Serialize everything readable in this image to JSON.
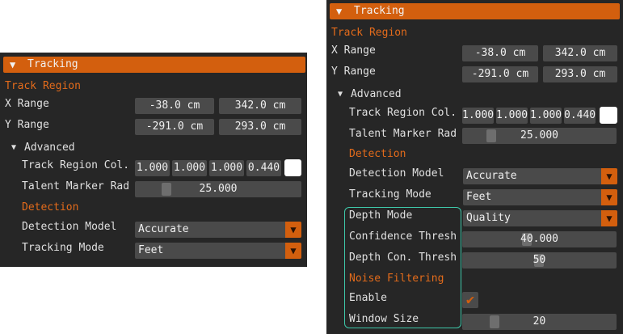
{
  "left_panel": {
    "header": {
      "arrow": "▼",
      "title": "Tracking"
    },
    "track_region": {
      "section": "Track Region",
      "x_range": {
        "label": "X Range",
        "min": "-38.0 cm",
        "max": "342.0 cm"
      },
      "y_range": {
        "label": "Y Range",
        "min": "-291.0 cm",
        "max": "293.0 cm"
      }
    },
    "advanced": {
      "arrow": "▼",
      "label": "Advanced",
      "track_region_color": {
        "label": "Track Region Col.",
        "r": "1.000",
        "g": "1.000",
        "b": "1.000",
        "a": "0.440"
      },
      "talent_marker_radius": {
        "label": "Talent Marker Rad",
        "value": "25.000"
      }
    },
    "detection": {
      "section": "Detection",
      "detection_model": {
        "label": "Detection Model",
        "value": "Accurate",
        "arrow": "▼"
      },
      "tracking_mode": {
        "label": "Tracking Mode",
        "value": "Feet",
        "arrow": "▼"
      }
    }
  },
  "right_panel": {
    "header": {
      "arrow": "▼",
      "title": "Tracking"
    },
    "track_region": {
      "section": "Track Region",
      "x_range": {
        "label": "X Range",
        "min": "-38.0 cm",
        "max": "342.0 cm"
      },
      "y_range": {
        "label": "Y Range",
        "min": "-291.0 cm",
        "max": "293.0 cm"
      }
    },
    "advanced": {
      "arrow": "▼",
      "label": "Advanced",
      "track_region_color": {
        "label": "Track Region Col.",
        "r": "1.000",
        "g": "1.000",
        "b": "1.000",
        "a": "0.440"
      },
      "talent_marker_radius": {
        "label": "Talent Marker Rad",
        "value": "25.000"
      }
    },
    "detection": {
      "section": "Detection",
      "detection_model": {
        "label": "Detection Model",
        "value": "Accurate",
        "arrow": "▼"
      },
      "tracking_mode": {
        "label": "Tracking Mode",
        "value": "Feet",
        "arrow": "▼"
      },
      "depth_mode": {
        "label": "Depth Mode",
        "value": "Quality",
        "arrow": "▼"
      },
      "confidence_threshold": {
        "label": "Confidence Thresh",
        "value": "40.000"
      },
      "depth_confidence_threshold": {
        "label": "Depth Con. Thresh",
        "value": "50"
      }
    },
    "noise_filtering": {
      "section": "Noise Filtering",
      "enable": {
        "label": "Enable",
        "checked": true,
        "mark": "✔"
      },
      "window_size": {
        "label": "Window Size",
        "value": "20"
      }
    }
  },
  "colors": {
    "panel_bg": "#262626",
    "header_orange": "#d35f0e",
    "section_orange": "#e36b1b",
    "frame_gray": "#4a4a4a",
    "highlight_teal": "#3ec7a9"
  }
}
